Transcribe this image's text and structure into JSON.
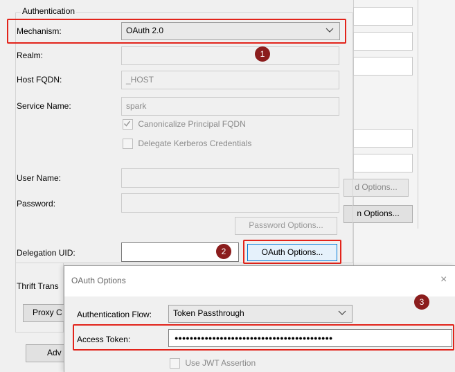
{
  "main": {
    "group_title": "Authentication",
    "mechanism": {
      "label": "Mechanism:",
      "value": "OAuth 2.0"
    },
    "realm": {
      "label": "Realm:",
      "value": ""
    },
    "host_fqdn": {
      "label": "Host FQDN:",
      "value": "_HOST"
    },
    "service_name": {
      "label": "Service Name:",
      "value": "spark"
    },
    "canonicalize": {
      "label": "Canonicalize Principal FQDN",
      "checked": true
    },
    "delegate_kerberos": {
      "label": "Delegate Kerberos Credentials",
      "checked": false
    },
    "user_name": {
      "label": "User Name:",
      "value": ""
    },
    "password": {
      "label": "Password:",
      "value": ""
    },
    "password_options_button": "Password Options...",
    "delegation_uid": {
      "label": "Delegation UID:",
      "value": ""
    },
    "oauth_options_button": "OAuth Options...",
    "thrift_transport_label": "Thrift Trans",
    "proxy_button": "Proxy C",
    "advanced_button": "Adv"
  },
  "right_ghost": {
    "button1_label": "d Options...",
    "button2_label": "n Options..."
  },
  "callouts": [
    "1",
    "2",
    "3"
  ],
  "colors": {
    "highlight": "#e2231a",
    "badge": "#8b1d1d"
  },
  "oauth_dialog": {
    "title": "OAuth Options",
    "close_glyph": "×",
    "flow": {
      "label": "Authentication Flow:",
      "value": "Token Passthrough"
    },
    "access_token": {
      "label": "Access Token:",
      "value": "●●●●●●●●●●●●●●●●●●●●●●●●●●●●●●●●●●●●●●●●●●"
    },
    "use_jwt": {
      "label": "Use JWT Assertion",
      "checked": false
    }
  }
}
